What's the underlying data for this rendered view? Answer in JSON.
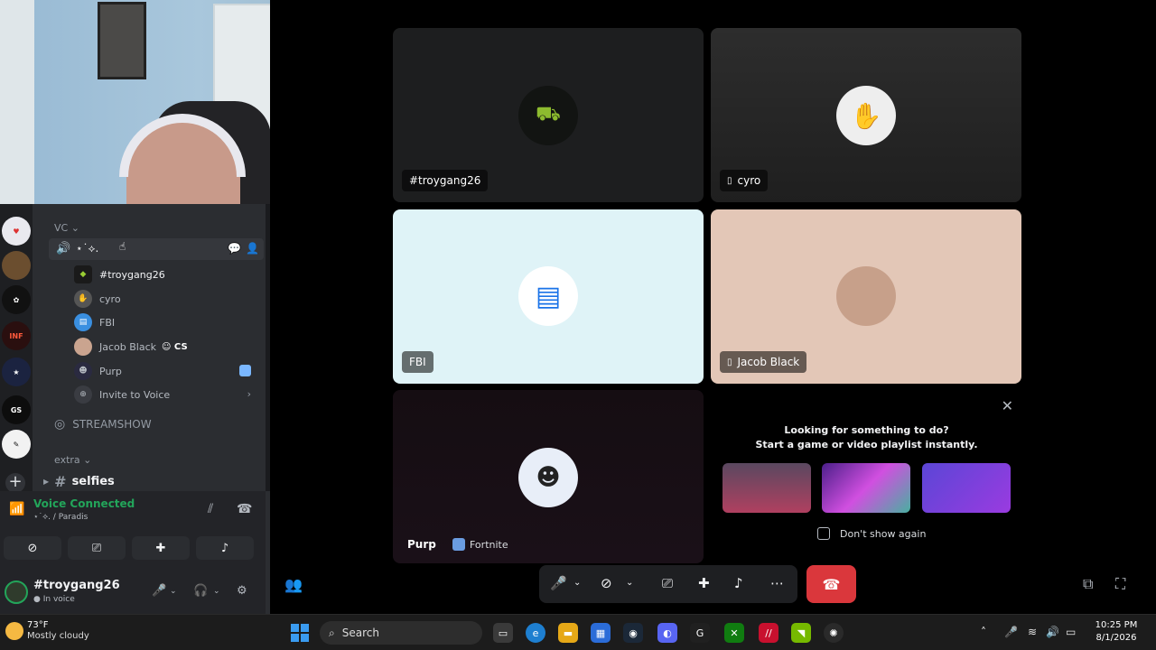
{
  "voice_sidebar": {
    "category_vc": "VC",
    "active_channel": "⋆˙⟡.",
    "members": [
      {
        "name": "#troygang26"
      },
      {
        "name": "cyro"
      },
      {
        "name": "FBI"
      },
      {
        "name": "Jacob Black",
        "badge": "CS"
      },
      {
        "name": "Purp"
      },
      {
        "name": "Invite to Voice"
      }
    ],
    "streamshow": "STREAMSHOW",
    "category_extra": "extra",
    "selfies": "selfies"
  },
  "voice_panel": {
    "status": "Voice Connected",
    "location": "⋆˙⟡. / Paradis"
  },
  "user": {
    "name": "#troygang26",
    "status": "In voice"
  },
  "tiles": [
    {
      "label": "#troygang26",
      "mobile": false
    },
    {
      "label": "cyro",
      "mobile": true
    },
    {
      "label": "FBI",
      "mobile": false
    },
    {
      "label": "Jacob Black",
      "mobile": true
    },
    {
      "label": "Purp",
      "activity": "Fortnite"
    }
  ],
  "promo": {
    "line1": "Looking for something to do?",
    "line2": "Start a game or video playlist instantly.",
    "dont_show": "Don't show again"
  },
  "taskbar": {
    "temp": "73°F",
    "weather": "Mostly cloudy",
    "search": "Search",
    "time": "10:25 PM",
    "date": "8/1/2026"
  },
  "colors": {
    "accent_green": "#23a55a",
    "hangup_red": "#da373c",
    "sidebar_bg": "#2b2d31"
  }
}
